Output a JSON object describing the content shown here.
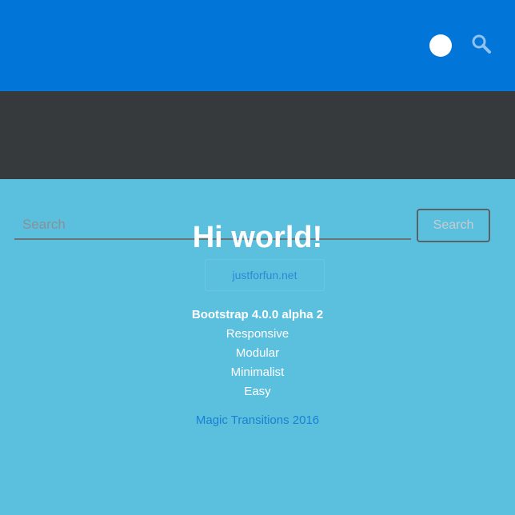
{
  "header": {
    "background": "#0275d8",
    "user_icon": "avatar-dot-icon",
    "search_icon": "search-icon"
  },
  "search": {
    "background": "#373a3c",
    "placeholder": "Search",
    "button_label": "Search"
  },
  "hero": {
    "background": "#5bc0de",
    "title": "Hi world!",
    "link_label": "justforfun.net",
    "features": [
      "Bootstrap 4.0.0 alpha 2",
      "Responsive",
      "Modular",
      "Minimalist",
      "Easy"
    ],
    "made_with": "Magic Transitions 2016"
  }
}
